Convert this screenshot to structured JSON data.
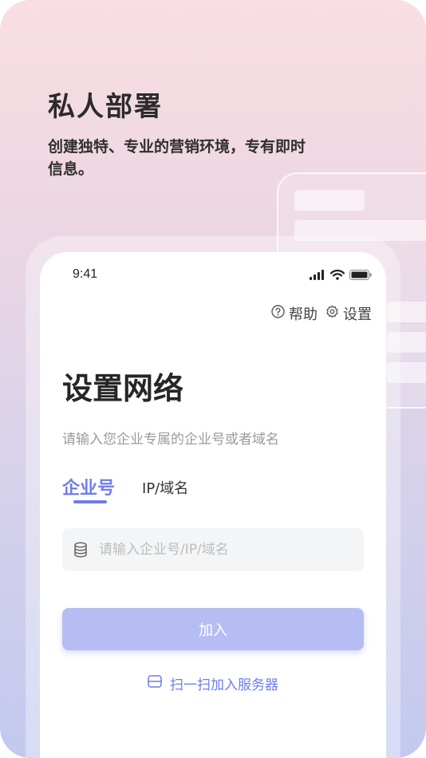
{
  "hero": {
    "title": "私人部署",
    "subtitle_line1": "创建独特、专业的营销环境，专有即时",
    "subtitle_line2": "信息。"
  },
  "status_bar": {
    "time": "9:41",
    "icons": [
      "signal-icon",
      "wifi-icon",
      "battery-icon"
    ]
  },
  "top_links": {
    "help_label": "帮助",
    "settings_label": "设置",
    "icons": [
      "question-circle-icon",
      "gear-icon"
    ]
  },
  "page": {
    "title": "设置网络",
    "subtitle": "请输入您企业专属的企业号或者域名"
  },
  "tabs": [
    {
      "label": "企业号",
      "active": true
    },
    {
      "label": "IP/域名",
      "active": false
    }
  ],
  "input": {
    "value": "",
    "placeholder": "请输入企业号/IP/域名",
    "icon": "database-icon"
  },
  "join_button": {
    "label": "加入"
  },
  "scan_link": {
    "label": "扫一扫加入服务器",
    "icon": "scan-icon"
  },
  "colors": {
    "accent": "#6f7de8",
    "button_disabled": "#b6bdf3",
    "input_bg": "#f4f5f7"
  }
}
